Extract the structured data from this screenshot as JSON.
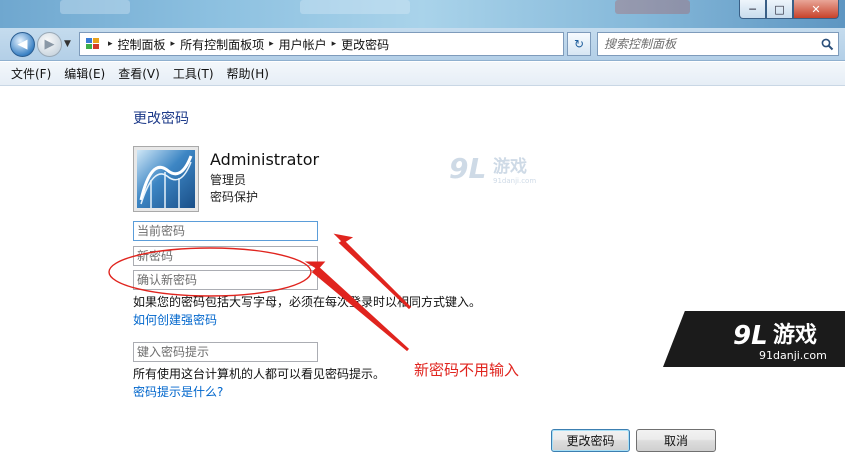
{
  "window": {
    "minimize_label": "─",
    "maximize_label": "□",
    "close_label": "✕"
  },
  "nav": {
    "back_icon": "◀",
    "forward_icon": "▶",
    "dropdown_icon": "▼",
    "breadcrumbs": [
      "控制面板",
      "所有控制面板项",
      "用户帐户",
      "更改密码"
    ],
    "separator": "▸",
    "refresh_icon": "↻",
    "search_placeholder": "搜索控制面板"
  },
  "menu": {
    "items": [
      "文件(F)",
      "编辑(E)",
      "查看(V)",
      "工具(T)",
      "帮助(H)"
    ]
  },
  "page": {
    "title": "更改密码",
    "user_name": "Administrator",
    "user_role": "管理员",
    "user_status": "密码保护",
    "current_password_placeholder": "当前密码",
    "new_password_placeholder": "新密码",
    "confirm_password_placeholder": "确认新密码",
    "caps_hint": "如果您的密码包括大写字母，必须在每次登录时以相同方式键入。",
    "strong_password_link": "如何创建强密码",
    "hint_placeholder": "键入密码提示",
    "hint_visibility_text": "所有使用这台计算机的人都可以看见密码提示。",
    "hint_help_link": "密码提示是什么?",
    "change_button": "更改密码",
    "cancel_button": "取消"
  },
  "annotation": {
    "text": "新密码不用输入",
    "color": "#e0241e"
  },
  "watermark": {
    "logo_number": "9L",
    "logo_text": "游戏",
    "domain": "91danji.com"
  },
  "colors": {
    "title_blue": "#1e3b8a",
    "link_blue": "#0066cc",
    "annotation_red": "#e0241e"
  }
}
